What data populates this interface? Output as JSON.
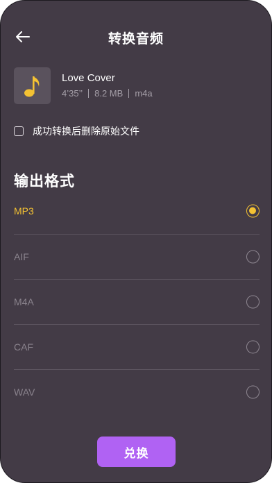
{
  "header": {
    "back_icon": "arrow-left-icon",
    "title": "转换音频"
  },
  "file": {
    "thumbnail_icon": "music-note-icon",
    "name": "Love Cover",
    "duration": "4’35’’",
    "size": "8.2 MB",
    "format": "m4a"
  },
  "delete_option": {
    "label": "成功转换后删除原始文件",
    "checked": false
  },
  "output_section": {
    "title": "输出格式",
    "selected": "MP3",
    "formats": [
      {
        "label": "MP3",
        "selected": true
      },
      {
        "label": "AIF",
        "selected": false
      },
      {
        "label": "M4A",
        "selected": false
      },
      {
        "label": "CAF",
        "selected": false
      },
      {
        "label": "WAV",
        "selected": false
      }
    ]
  },
  "convert_button": {
    "label": "兑换"
  },
  "colors": {
    "background": "#433b46",
    "accent": "#f4c233",
    "button": "#b062f3",
    "text": "#ffffff",
    "muted": "#8a838d"
  }
}
